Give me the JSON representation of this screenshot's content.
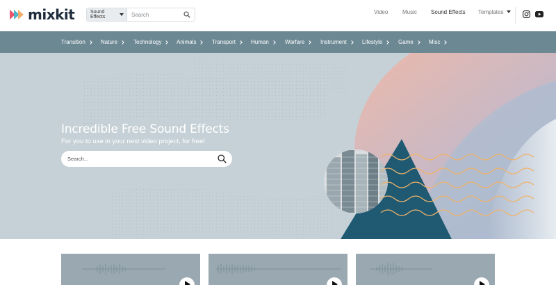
{
  "brand": {
    "name": "mixkit"
  },
  "search": {
    "category": "Sound Effects",
    "placeholder": "Search"
  },
  "topnav": {
    "video": "Video",
    "music": "Music",
    "sound_effects": "Sound Effects",
    "templates": "Templates"
  },
  "categories": [
    "Transition",
    "Nature",
    "Technology",
    "Animals",
    "Transport",
    "Human",
    "Warfare",
    "Instrument",
    "Lifestyle",
    "Game",
    "Misc"
  ],
  "hero": {
    "title": "Incredible Free Sound Effects",
    "subtitle": "For you to use in your next video project, for free!",
    "search_placeholder": "Search..."
  },
  "colors": {
    "category_bar": "#6c8893",
    "hero_background": "#c6d1d7",
    "teal_shape": "#1f5a72",
    "peach_shape": "#f3b9a6",
    "wave_lines": "#f1b36a"
  },
  "icons": {
    "search": "search-icon",
    "instagram": "instagram-icon",
    "youtube": "youtube-icon",
    "play": "play-icon"
  }
}
